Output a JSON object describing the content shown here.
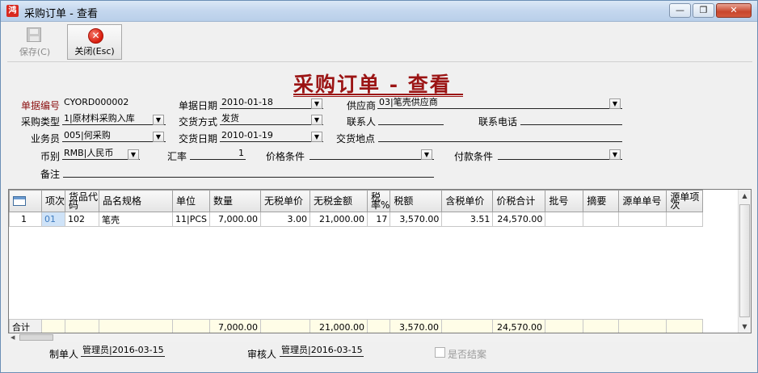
{
  "window": {
    "title": "采购订单 - 查看",
    "app_icon": "鸿",
    "minimize": "—",
    "restore": "❐",
    "close": "✕"
  },
  "toolbar": {
    "save_label": "保存(C)",
    "close_label": "关闭(Esc)"
  },
  "doc_title": "采购订单 - 查看",
  "form": {
    "doc_no_label": "单据编号",
    "doc_no": "CYORD000002",
    "doc_date_label": "单据日期",
    "doc_date": "2010-01-18",
    "supplier_label": "供应商",
    "supplier": "03|笔壳供应商",
    "purchase_type_label": "采购类型",
    "purchase_type": "1|原材料采购入库",
    "delivery_method_label": "交货方式",
    "delivery_method": "发货",
    "contact_label": "联系人",
    "contact": "",
    "phone_label": "联系电话",
    "phone": "",
    "salesman_label": "业务员",
    "salesman": "005|何采购",
    "delivery_date_label": "交货日期",
    "delivery_date": "2010-01-19",
    "delivery_place_label": "交货地点",
    "delivery_place": "",
    "currency_label": "币别",
    "currency": "RMB|人民币",
    "rate_label": "汇率",
    "rate": "1",
    "price_terms_label": "价格条件",
    "price_terms": "",
    "payment_terms_label": "付款条件",
    "payment_terms": "",
    "remark_label": "备注",
    "remark": ""
  },
  "grid": {
    "headers": [
      "",
      "项次",
      "货品代码",
      "品名规格",
      "单位",
      "数量",
      "无税单价",
      "无税金额",
      "税率%",
      "税额",
      "含税单价",
      "价税合计",
      "批号",
      "摘要",
      "源单单号",
      "源单项次"
    ],
    "rows": [
      [
        "1",
        "01",
        "102",
        "笔壳",
        "11|PCS",
        "7,000.00",
        "3.00",
        "21,000.00",
        "17",
        "3,570.00",
        "3.51",
        "24,570.00",
        "",
        "",
        "",
        ""
      ]
    ],
    "totals": [
      "合计",
      "",
      "",
      "",
      "",
      "7,000.00",
      "",
      "21,000.00",
      "",
      "3,570.00",
      "",
      "24,570.00",
      "",
      "",
      "",
      ""
    ]
  },
  "footer": {
    "creator_label": "制单人",
    "creator": "管理员|2016-03-15",
    "reviewer_label": "审核人",
    "reviewer": "管理员|2016-03-15",
    "closed_label": "是否结案"
  }
}
